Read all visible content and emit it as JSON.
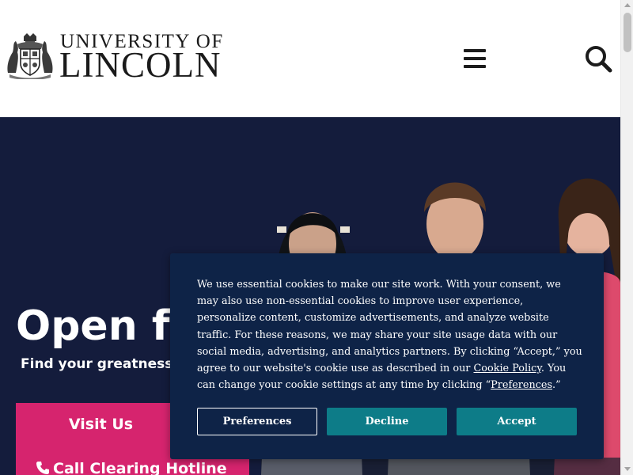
{
  "header": {
    "logo": {
      "line1": "UNIVERSITY OF",
      "line2": "LINCOLN",
      "crest_icon": "university-crest"
    },
    "menu_icon": "hamburger-menu-icon",
    "search_icon": "search-icon"
  },
  "hero": {
    "heading": "Open fo",
    "subheading": "Find your greatness",
    "visit_label": "Visit Us",
    "call_label": "Call Clearing Hotline",
    "call_icon": "phone-icon",
    "background_color": "#141c3c",
    "cta_color": "#d6246e"
  },
  "cookie_banner": {
    "text_1": "We use essential cookies to make our site work. With your consent, we may also use non-essential cookies to improve user experience, personalize content, customize advertisements, and analyze website traffic. For these reasons, we may share your site usage data with our social media, advertising, and analytics partners. By clicking “Accept,” you agree to our website's cookie use as described in our ",
    "cookie_policy_link": "Cookie Policy",
    "text_2": ". You can change your cookie settings at any time by clicking “",
    "preferences_link": "Preferences",
    "text_3": ".”",
    "preferences_button": "Preferences",
    "decline_button": "Decline",
    "accept_button": "Accept",
    "background_color": "#0e2347",
    "button_color": "#0d7c88"
  }
}
